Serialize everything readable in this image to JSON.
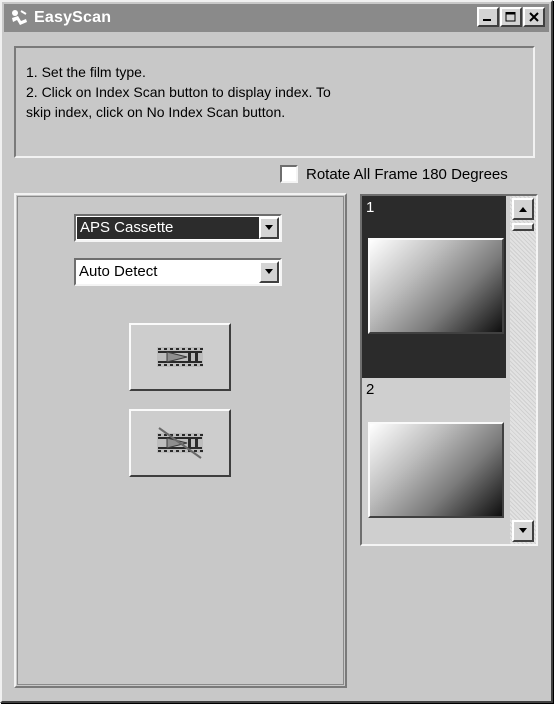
{
  "window": {
    "title": "EasyScan",
    "controls": {
      "minimize": "minimize-icon",
      "maximize": "maximize-icon",
      "close": "close-icon"
    }
  },
  "instructions": {
    "line1": "1. Set the film type.",
    "line2": "2. Click on Index Scan button to display index. To",
    "line3": "skip index, click on No Index Scan button."
  },
  "rotate": {
    "label": "Rotate All Frame 180 Degrees",
    "checked": false
  },
  "film_type": {
    "selected": "APS Cassette"
  },
  "detect_mode": {
    "selected": "Auto Detect"
  },
  "buttons": {
    "index_scan": "index-scan-icon",
    "no_index_scan": "no-index-scan-icon"
  },
  "frames": [
    {
      "number": "1",
      "selected": true
    },
    {
      "number": "2",
      "selected": false
    }
  ]
}
